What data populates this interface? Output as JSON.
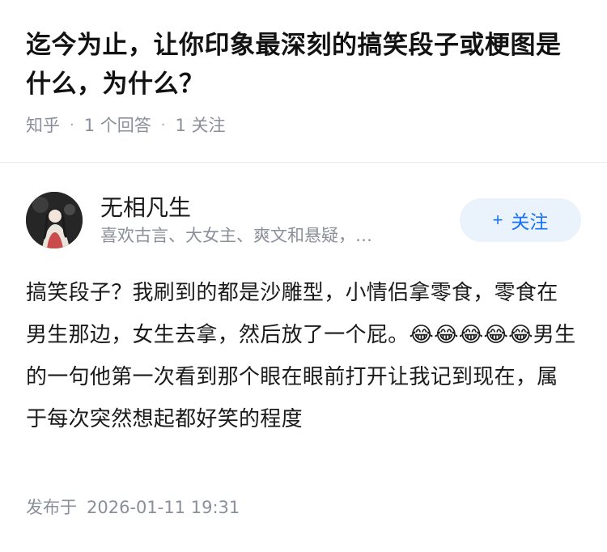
{
  "question": {
    "title": "迄今为止，让你印象最深刻的搞笑段子或梗图是什么，为什么？",
    "source": "知乎",
    "answer_count": "1 个回答",
    "follower_count": "1 关注"
  },
  "author": {
    "name": "无相凡生",
    "bio": "喜欢古言、大女主、爽文和悬疑，…",
    "follow_label": "关注",
    "follow_icon": "plus-icon"
  },
  "answer": {
    "content": "搞笑段子？我刷到的都是沙雕型，小情侣拿零食，零食在男生那边，女生去拿，然后放了一个屁。😂😂😂😂😂男生的一句他第一次看到那个眼在眼前打开让我记到现在，属于每次突然想起都好笑的程度",
    "publish_label": "发布于",
    "publish_time": "2026-01-11 19:31"
  },
  "colors": {
    "accent": "#1772f6",
    "follow_bg": "#eaf2fc",
    "meta_text": "#8a8f99"
  }
}
